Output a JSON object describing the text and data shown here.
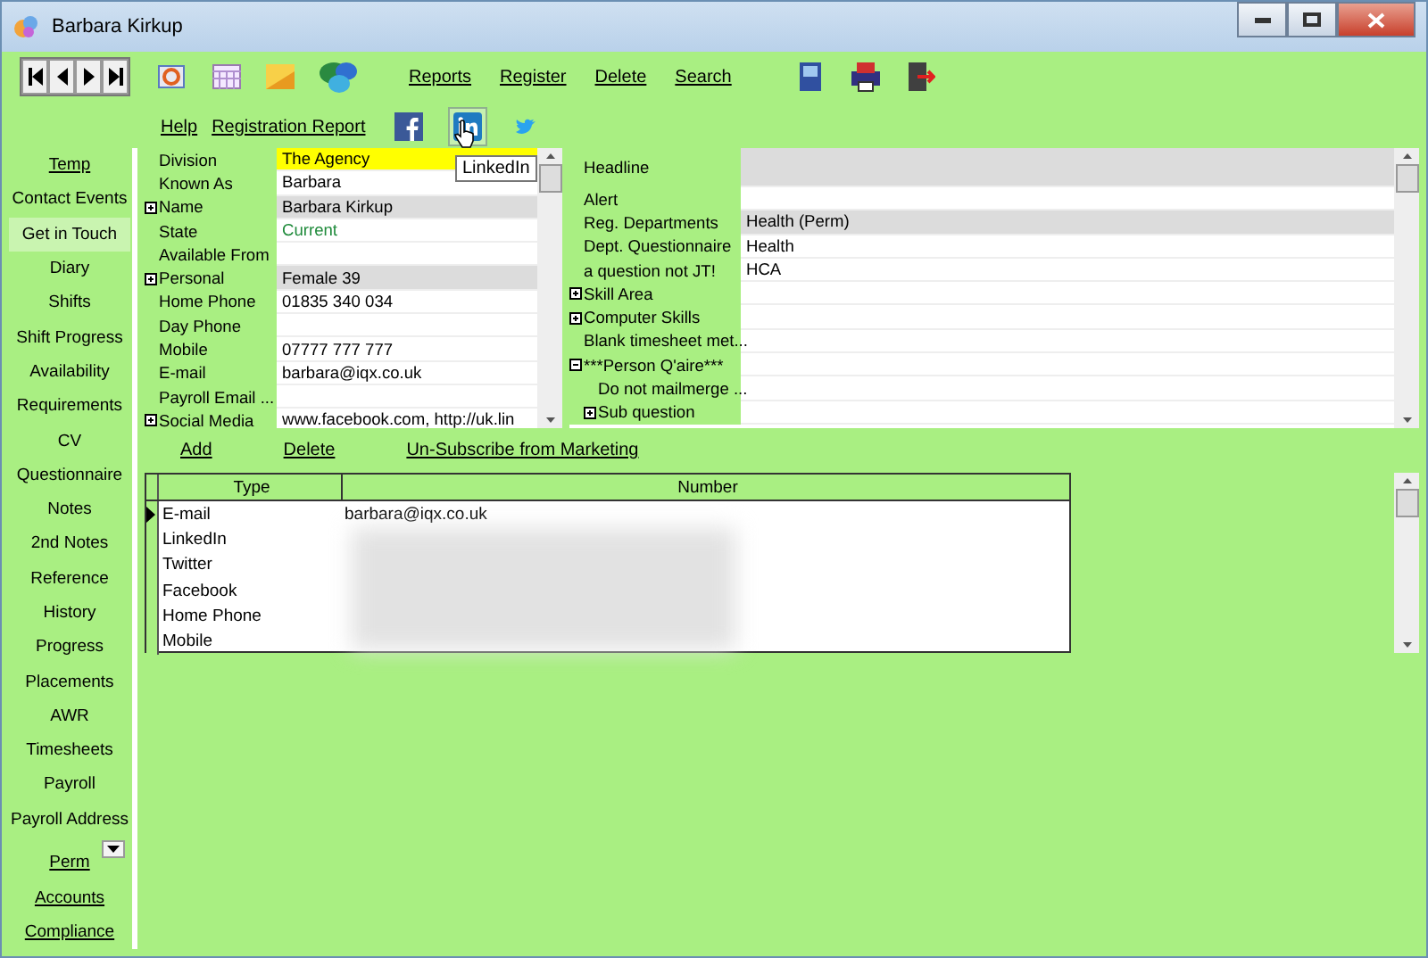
{
  "window": {
    "title": "Barbara Kirkup"
  },
  "toolbar": {
    "links": [
      "Reports",
      "Register",
      "Delete",
      "Search"
    ],
    "links2": [
      "Help",
      "Registration Report"
    ],
    "tooltip": "LinkedIn"
  },
  "sidebar": {
    "items": [
      {
        "label": "Temp",
        "kind": "section",
        "selected": false
      },
      {
        "label": "Contact Events",
        "kind": "tab",
        "selected": false
      },
      {
        "label": "Get in Touch",
        "kind": "tab",
        "selected": true
      },
      {
        "label": "Diary",
        "kind": "tab",
        "selected": false
      },
      {
        "label": "Shifts",
        "kind": "tab",
        "selected": false
      },
      {
        "label": "Shift Progress",
        "kind": "tab",
        "selected": false
      },
      {
        "label": "Availability",
        "kind": "tab",
        "selected": false
      },
      {
        "label": "Requirements",
        "kind": "tab",
        "selected": false
      },
      {
        "label": "CV",
        "kind": "tab",
        "selected": false
      },
      {
        "label": "Questionnaire",
        "kind": "tab",
        "selected": false
      },
      {
        "label": "Notes",
        "kind": "tab",
        "selected": false
      },
      {
        "label": "2nd Notes",
        "kind": "tab",
        "selected": false
      },
      {
        "label": "Reference",
        "kind": "tab",
        "selected": false
      },
      {
        "label": "History",
        "kind": "tab",
        "selected": false
      },
      {
        "label": "Progress",
        "kind": "tab",
        "selected": false
      },
      {
        "label": "Placements",
        "kind": "tab",
        "selected": false
      },
      {
        "label": "AWR",
        "kind": "tab",
        "selected": false
      },
      {
        "label": "Timesheets",
        "kind": "tab",
        "selected": false
      },
      {
        "label": "Payroll",
        "kind": "tab",
        "selected": false
      },
      {
        "label": "Payroll Address",
        "kind": "tab",
        "selected": false
      }
    ],
    "sections": [
      "Perm",
      "Accounts",
      "Compliance"
    ]
  },
  "details": [
    {
      "label": "Division",
      "value": "The Agency",
      "kind": "highlight"
    },
    {
      "label": "Known As",
      "value": "Barbara",
      "kind": "plain"
    },
    {
      "label": "Name",
      "value": "Barbara Kirkup",
      "kind": "shaded",
      "expanded": false
    },
    {
      "label": "State",
      "value": "Current",
      "kind": "status"
    },
    {
      "label": "Available From",
      "kind": "plain"
    },
    {
      "label": "Personal",
      "value": "Female 39",
      "kind": "shaded",
      "expanded": false
    },
    {
      "label": "Home Phone",
      "value": "01835 340 034",
      "kind": "plain"
    },
    {
      "label": "Day Phone",
      "kind": "plain"
    },
    {
      "label": "Mobile",
      "value": "07777 777 777",
      "kind": "plain"
    },
    {
      "label": "E-mail",
      "value": "barbara@iqx.co.uk",
      "kind": "plain"
    },
    {
      "label": "Payroll Email ...",
      "kind": "plain"
    },
    {
      "label": "Social Media",
      "value": "www.facebook.com, http://uk.lin",
      "kind": "plain",
      "expanded": false
    }
  ],
  "profile": [
    {
      "label": "Headline",
      "kind": "tall"
    },
    {
      "label": "Alert",
      "kind": "plain"
    },
    {
      "label": "Reg. Departments",
      "value": "Health (Perm)",
      "kind": "shaded"
    },
    {
      "label": "Dept. Questionnaire",
      "value": "Health",
      "kind": "plain"
    },
    {
      "label": "a question not JT!",
      "value": "HCA",
      "kind": "plain"
    },
    {
      "label": "Skill Area",
      "kind": "plain",
      "expanded": false
    },
    {
      "label": "Computer Skills",
      "kind": "plain",
      "expanded": false
    },
    {
      "label": "Blank timesheet met...",
      "kind": "plain"
    },
    {
      "label": "***Person Q'aire***",
      "kind": "plain",
      "expanded": true,
      "children": [
        {
          "label": "Do not mailmerge ..."
        },
        {
          "label": "Sub question",
          "expanded": false
        }
      ]
    }
  ],
  "contacts": {
    "actions": [
      "Add",
      "Delete",
      "Un-Subscribe from Marketing"
    ],
    "columns": [
      "Type",
      "Number"
    ],
    "rows": [
      {
        "type": "E-mail",
        "number": "barbara@iqx.co.uk",
        "selected": true
      },
      {
        "type": "LinkedIn",
        "selected": false
      },
      {
        "type": "Twitter",
        "selected": false
      },
      {
        "type": "Facebook",
        "selected": false
      },
      {
        "type": "Home Phone",
        "selected": false
      },
      {
        "type": "Mobile",
        "selected": false
      }
    ]
  }
}
